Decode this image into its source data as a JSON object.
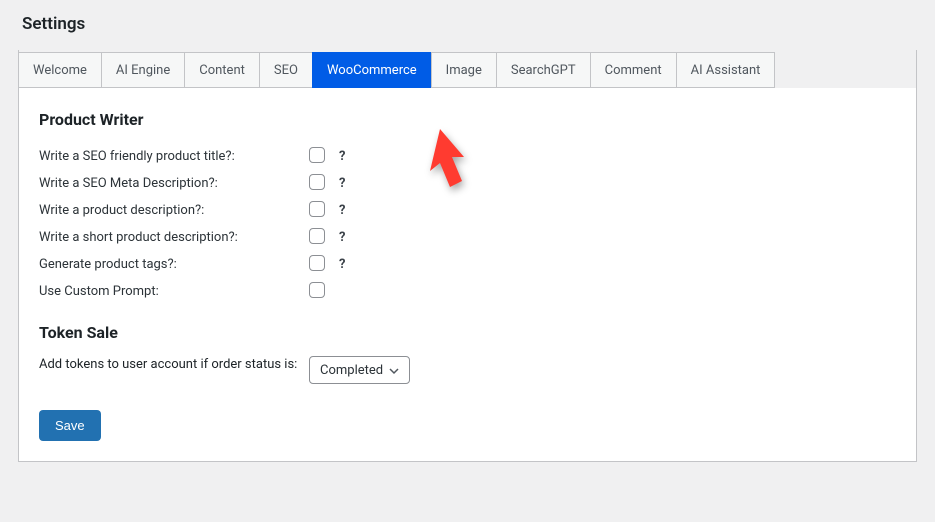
{
  "page": {
    "title": "Settings"
  },
  "tabs": [
    {
      "id": "welcome",
      "label": "Welcome",
      "active": false
    },
    {
      "id": "ai-engine",
      "label": "AI Engine",
      "active": false
    },
    {
      "id": "content",
      "label": "Content",
      "active": false
    },
    {
      "id": "seo",
      "label": "SEO",
      "active": false
    },
    {
      "id": "woocommerce",
      "label": "WooCommerce",
      "active": true
    },
    {
      "id": "image",
      "label": "Image",
      "active": false
    },
    {
      "id": "searchgpt",
      "label": "SearchGPT",
      "active": false
    },
    {
      "id": "comment",
      "label": "Comment",
      "active": false
    },
    {
      "id": "ai-assistant",
      "label": "AI Assistant",
      "active": false
    }
  ],
  "sections": {
    "product_writer": {
      "title": "Product Writer",
      "fields": [
        {
          "id": "seo-title",
          "label": "Write a SEO friendly product title?:",
          "help": "?"
        },
        {
          "id": "seo-meta",
          "label": "Write a SEO Meta Description?:",
          "help": "?"
        },
        {
          "id": "prod-desc",
          "label": "Write a product description?:",
          "help": "?"
        },
        {
          "id": "short-desc",
          "label": "Write a short product description?:",
          "help": "?"
        },
        {
          "id": "prod-tags",
          "label": "Generate product tags?:",
          "help": "?"
        },
        {
          "id": "custom-prompt",
          "label": "Use Custom Prompt:",
          "help": ""
        }
      ]
    },
    "token_sale": {
      "title": "Token Sale",
      "field_label": "Add tokens to user account if order status is:",
      "select_value": "Completed"
    }
  },
  "actions": {
    "save": "Save"
  },
  "colors": {
    "tab_active_bg": "#0c73d8",
    "arrow": "#ff3b30"
  }
}
